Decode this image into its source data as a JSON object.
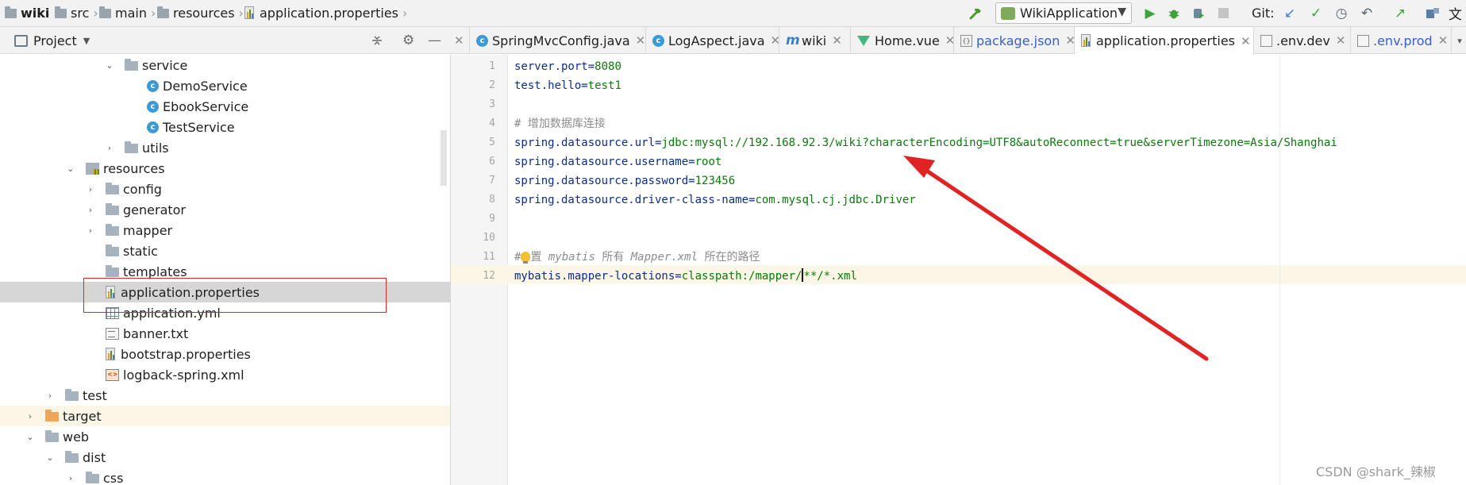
{
  "breadcrumb": {
    "items": [
      {
        "label": "wiki",
        "icon": "folder-icon",
        "bold": true
      },
      {
        "label": "src",
        "icon": "folder-icon"
      },
      {
        "label": "main",
        "icon": "folder-icon"
      },
      {
        "label": "resources",
        "icon": "resources-folder-icon"
      },
      {
        "label": "application.properties",
        "icon": "properties-file-icon"
      }
    ]
  },
  "toolbar": {
    "run_config": "WikiApplication",
    "git_label": "Git:",
    "truncated_text": "文"
  },
  "project_panel": {
    "title": "Project"
  },
  "tree": {
    "service": "service",
    "demo_service": "DemoService",
    "ebook_service": "EbookService",
    "test_service": "TestService",
    "utils": "utils",
    "resources": "resources",
    "config": "config",
    "generator": "generator",
    "mapper": "mapper",
    "static": "static",
    "templates": "templates",
    "application_properties": "application.properties",
    "application_yml": "application.yml",
    "banner": "banner.txt",
    "bootstrap": "bootstrap.properties",
    "logback": "logback-spring.xml",
    "test": "test",
    "target": "target",
    "web": "web",
    "dist": "dist",
    "css": "css"
  },
  "tabs": [
    {
      "label": "SpringMvcConfig.java",
      "icon": "java-class-icon"
    },
    {
      "label": "LogAspect.java",
      "icon": "java-class-icon"
    },
    {
      "label": "wiki",
      "icon": "module-icon"
    },
    {
      "label": "Home.vue",
      "icon": "vue-icon"
    },
    {
      "label": "package.json",
      "icon": "json-icon"
    },
    {
      "label": "application.properties",
      "icon": "properties-file-icon",
      "active": true
    },
    {
      "label": ".env.dev",
      "icon": "file-icon"
    },
    {
      "label": ".env.prod",
      "icon": "file-icon"
    }
  ],
  "editor": {
    "line_numbers": [
      "1",
      "2",
      "3",
      "4",
      "5",
      "6",
      "7",
      "8",
      "9",
      "10",
      "11",
      "12"
    ],
    "lines": {
      "l1_key": "server.port",
      "l1_val": "8080",
      "l2_key": "test.hello",
      "l2_val": "test1",
      "l4_comment": "# 增加数据库连接",
      "l5_key": "spring.datasource.url",
      "l5_val": "jdbc:mysql://192.168.92.3/wiki?characterEncoding=UTF8&autoReconnect=true&serverTimezone=Asia/Shanghai",
      "l6_key": "spring.datasource.username",
      "l6_val": "root",
      "l7_key": "spring.datasource.password",
      "l7_val": "123456",
      "l8_key": "spring.datasource.driver-class-name",
      "l8_val": "com.mysql.cj.jdbc.Driver",
      "l11_hash": "#",
      "l11_a": "置 ",
      "l11_mybatis": "mybatis",
      "l11_b": " 所有 ",
      "l11_mapper": "Mapper.xml",
      "l11_c": " 所在的路径",
      "l12_key": "mybatis.mapper-locations",
      "l12_val_a": "classpath:/mapper/",
      "l12_val_b": "**/*.xml"
    }
  },
  "watermark": "CSDN @shark_辣椒",
  "colors": {
    "annotation_red": "#e02323",
    "property_key": "#0b2d8b",
    "property_value": "#0a7a0a",
    "comment": "#8c8c8c",
    "selection": "#d6d6d6"
  }
}
